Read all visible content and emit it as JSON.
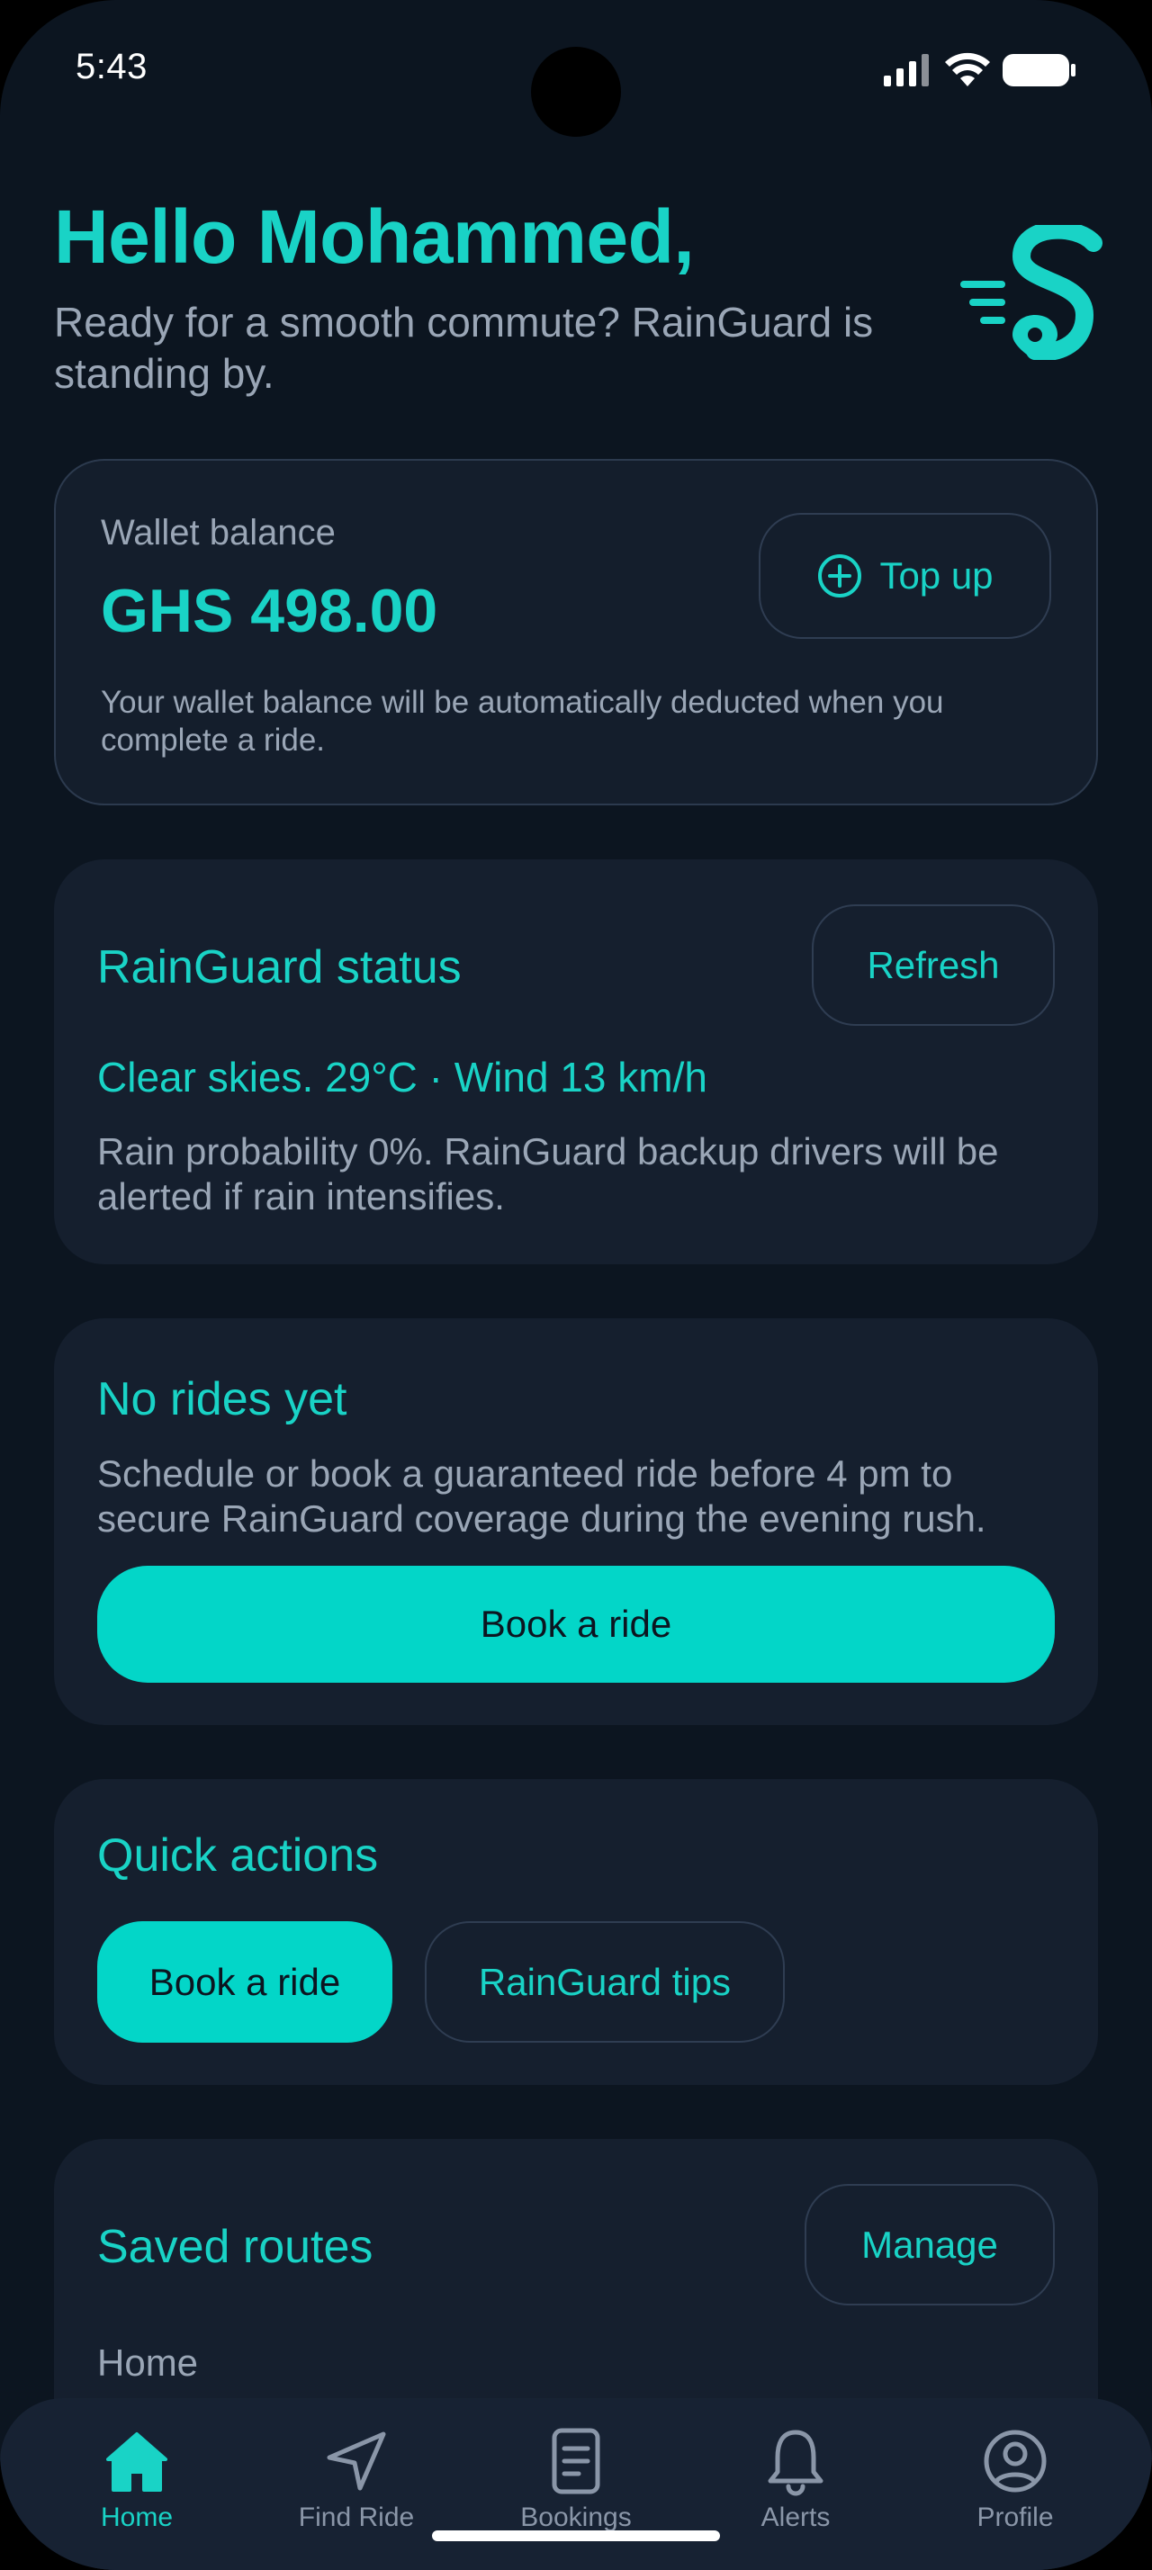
{
  "status_bar": {
    "time": "5:43"
  },
  "header": {
    "greeting": "Hello Mohammed,",
    "subtitle": "Ready for a smooth commute? RainGuard is standing by."
  },
  "wallet": {
    "label": "Wallet balance",
    "amount": "GHS 498.00",
    "topup_label": "Top up",
    "note": "Your wallet balance will be automatically deducted when you complete a ride."
  },
  "rainguard_status": {
    "title": "RainGuard status",
    "refresh_label": "Refresh",
    "weather": "Clear skies. 29°C · Wind 13 km/h",
    "details": "Rain probability 0%. RainGuard backup drivers will be alerted if rain intensifies."
  },
  "rides": {
    "title": "No rides yet",
    "description": "Schedule or book a guaranteed ride before 4 pm to secure RainGuard coverage during the evening rush.",
    "book_label": "Book a ride"
  },
  "quick_actions": {
    "title": "Quick actions",
    "book_label": "Book a ride",
    "tips_label": "RainGuard tips"
  },
  "saved_routes": {
    "title": "Saved routes",
    "manage_label": "Manage",
    "first_route": "Home"
  },
  "tabs": [
    {
      "label": "Home",
      "icon": "home-icon",
      "active": true
    },
    {
      "label": "Find Ride",
      "icon": "navigation-arrow-icon",
      "active": false
    },
    {
      "label": "Bookings",
      "icon": "document-icon",
      "active": false
    },
    {
      "label": "Alerts",
      "icon": "bell-icon",
      "active": false
    },
    {
      "label": "Profile",
      "icon": "user-circle-icon",
      "active": false
    }
  ],
  "colors": {
    "accent": "#19d3c6",
    "background": "#0c1520",
    "card": "#151f2e",
    "muted_text": "#9aa6b6"
  }
}
